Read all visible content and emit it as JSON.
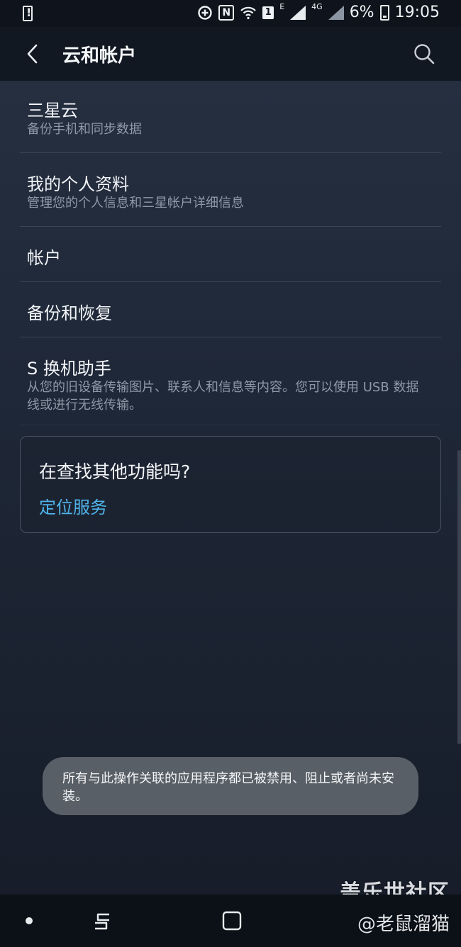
{
  "status_bar": {
    "nfc": "N",
    "sim": "1",
    "e_label": "E",
    "network": "4G",
    "battery_percent": "6%",
    "time": "19:05"
  },
  "header": {
    "title": "云和帐户"
  },
  "menu": [
    {
      "title": "三星云",
      "subtitle": "备份手机和同步数据"
    },
    {
      "title": "我的个人资料",
      "subtitle": "管理您的个人信息和三星帐户详细信息"
    },
    {
      "title": "帐户"
    },
    {
      "title": "备份和恢复"
    },
    {
      "title": "S 换机助手",
      "subtitle": "从您的旧设备传输图片、联系人和信息等内容。您可以使用 USB 数据线或进行无线传输。"
    }
  ],
  "suggestion_card": {
    "title": "在查找其他功能吗?",
    "link": "定位服务"
  },
  "toast": {
    "message": "所有与此操作关联的应用程序都已被禁用、阻止或者尚未安装。"
  },
  "watermark": {
    "line1": "盖乐世社区",
    "line2": "@老鼠溜猫"
  },
  "colors": {
    "link": "#4fb3ea",
    "background": "#1f2838"
  }
}
